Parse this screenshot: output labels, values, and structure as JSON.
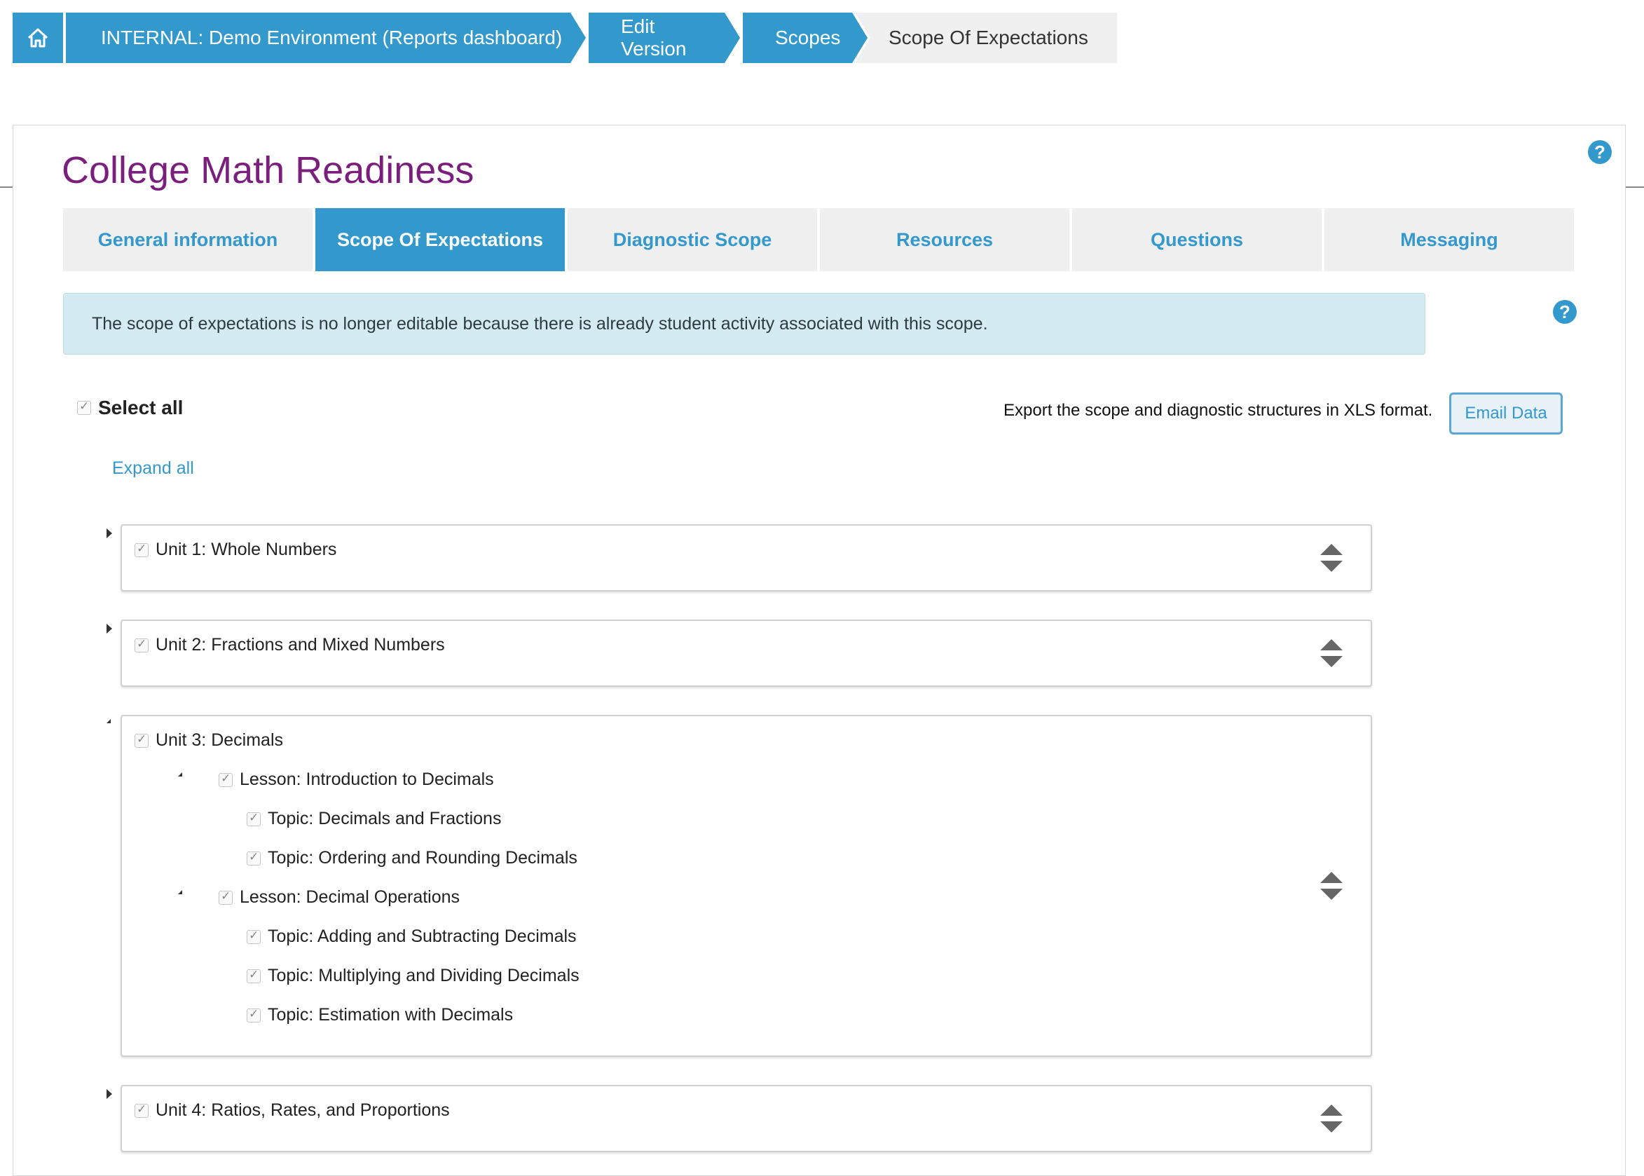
{
  "breadcrumb": {
    "home_icon": "home-icon",
    "items": [
      {
        "label": "INTERNAL: Demo Environment (Reports dashboard)"
      },
      {
        "label": "Edit Version"
      },
      {
        "label": "Scopes"
      },
      {
        "label": "Scope Of Expectations"
      }
    ]
  },
  "page": {
    "title": "College Math Readiness",
    "help_glyph": "?"
  },
  "tabs": [
    {
      "label": "General information",
      "active": false
    },
    {
      "label": "Scope Of Expectations",
      "active": true
    },
    {
      "label": "Diagnostic Scope",
      "active": false
    },
    {
      "label": "Resources",
      "active": false
    },
    {
      "label": "Questions",
      "active": false
    },
    {
      "label": "Messaging",
      "active": false
    }
  ],
  "notice": "The scope of expectations is no longer editable because there is already student activity associated with this scope.",
  "controls": {
    "select_all": "Select all",
    "export_text": "Export the scope and diagnostic structures in XLS format.",
    "email_button": "Email Data",
    "expand_all": "Expand all"
  },
  "units": [
    {
      "label": "Unit 1: Whole Numbers",
      "expanded": false
    },
    {
      "label": "Unit 2: Fractions and Mixed Numbers",
      "expanded": false
    },
    {
      "label": "Unit 3: Decimals",
      "expanded": true,
      "lessons": [
        {
          "label": "Lesson: Introduction to Decimals",
          "topics": [
            "Topic: Decimals and Fractions",
            "Topic: Ordering and Rounding Decimals"
          ]
        },
        {
          "label": "Lesson: Decimal Operations",
          "topics": [
            "Topic: Adding and Subtracting Decimals",
            "Topic: Multiplying and Dividing Decimals",
            "Topic: Estimation with Decimals"
          ]
        }
      ]
    },
    {
      "label": "Unit 4: Ratios, Rates, and Proportions",
      "expanded": false
    }
  ],
  "colors": {
    "accent": "#3399cc",
    "title": "#7a1f7e",
    "notice_bg": "#d4ecf1"
  }
}
